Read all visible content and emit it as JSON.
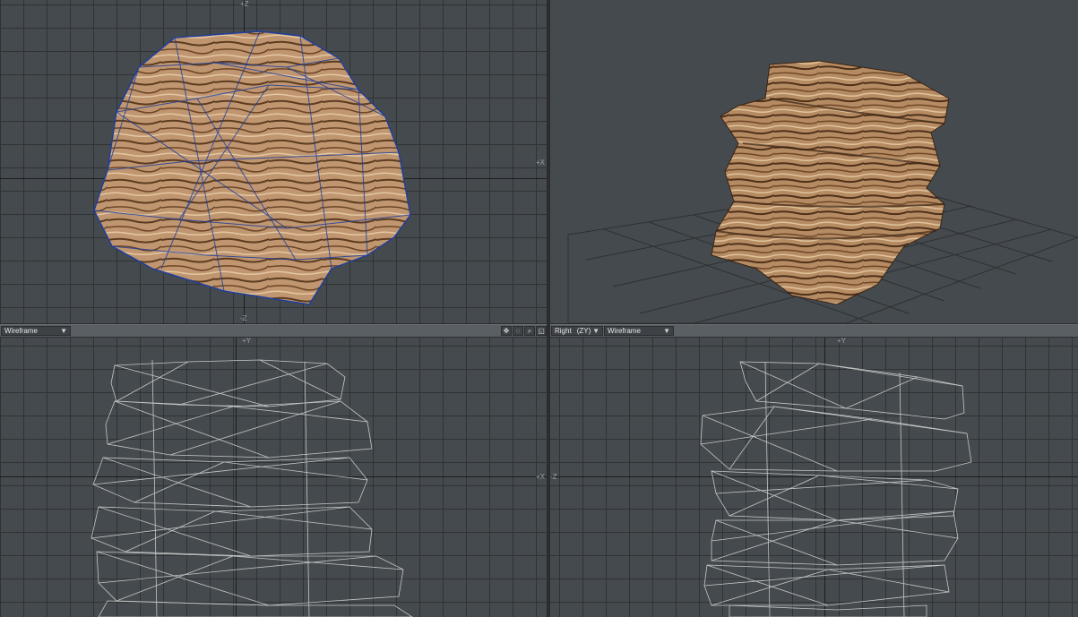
{
  "viewports": {
    "top_left": {
      "axis_top": "+Z",
      "axis_right": "+X",
      "axis_bottom": "-Z"
    },
    "top_right": {},
    "bottom_left": {
      "render_mode": "Wireframe",
      "axis_top": "+Y",
      "axis_right": "+X",
      "controls": [
        "move-icon",
        "rotate-icon",
        "zoom-icon",
        "maximize-icon"
      ]
    },
    "bottom_right": {
      "view": "Right",
      "plane": "(ZY)",
      "render_mode": "Wireframe",
      "axis_top": "+Y",
      "axis_left": "-Z"
    }
  },
  "colors": {
    "viewport_bg": "#454a4e",
    "grid_line": "#2f3336",
    "wire_blue": "#1f3f9c",
    "wire_white": "#dcdcdc",
    "rock_light": "#c9a27a",
    "rock_dark": "#5a3a1f"
  }
}
